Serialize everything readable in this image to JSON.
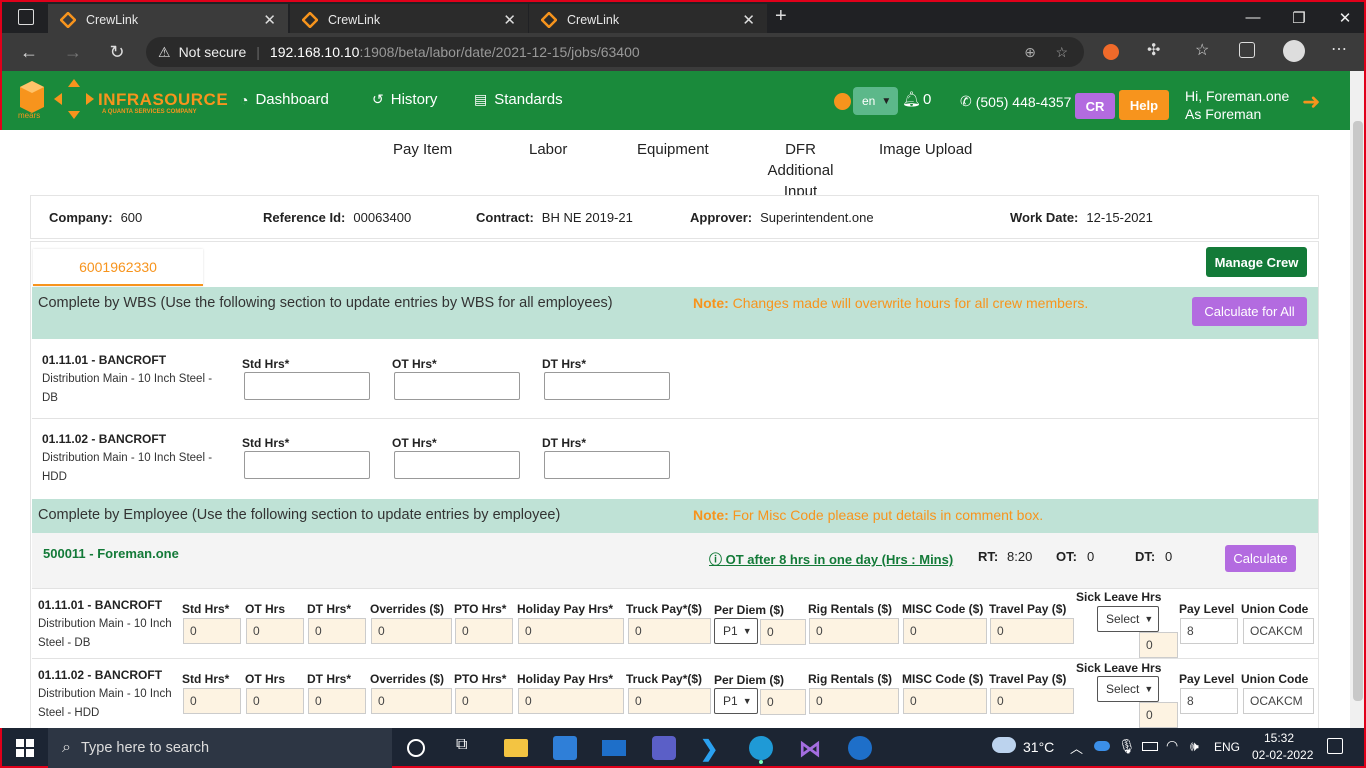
{
  "browser": {
    "tabs": [
      {
        "title": "CrewLink"
      },
      {
        "title": "CrewLink"
      },
      {
        "title": "CrewLink"
      }
    ],
    "security_label": "Not secure",
    "url_host": "192.168.10.10",
    "url_path": ":1908/beta/labor/date/2021-12-15/jobs/63400"
  },
  "header": {
    "logo_text": "INFRASOURCE",
    "logo_sub": "A QUANTA SERVICES COMPANY",
    "logo_mears": "mears",
    "nav": [
      {
        "label": "Dashboard",
        "icon": "dashboard-icon"
      },
      {
        "label": "History",
        "icon": "history-icon"
      },
      {
        "label": "Standards",
        "icon": "document-icon"
      }
    ],
    "language": "en",
    "notif_count": "0",
    "phone": "(505) 448-4357",
    "cr_label": "CR",
    "help_label": "Help",
    "greeting": "Hi, Foreman.one",
    "role": "As Foreman"
  },
  "subnav": {
    "items": [
      "Pay Item",
      "Labor",
      "Equipment",
      "DFR Additional",
      "Input",
      "Image Upload"
    ]
  },
  "info": {
    "company_label": "Company:",
    "company": "600",
    "ref_label": "Reference Id:",
    "ref": "00063400",
    "contract_label": "Contract:",
    "contract": "BH NE 2019-21",
    "approver_label": "Approver:",
    "approver": "Superintendent.one",
    "date_label": "Work Date:",
    "date": "12-15-2021"
  },
  "crew": {
    "tab_id": "6001962330",
    "manage_label": "Manage Crew",
    "wbs_title": "Complete by WBS (Use the following section to update entries by WBS for all employees)",
    "note_label": "Note:",
    "wbs_note": "Changes made will overwrite hours for all crew members.",
    "calc_all_label": "Calculate for All",
    "wbs_rows": [
      {
        "code": "01.11.01 - BANCROFT",
        "desc1": "Distribution Main - 10 Inch Steel -",
        "desc2": "DB"
      },
      {
        "code": "01.11.02 - BANCROFT",
        "desc1": "Distribution Main - 10 Inch Steel -",
        "desc2": "HDD"
      }
    ],
    "wbs_fields": [
      "Std Hrs*",
      "OT Hrs*",
      "DT Hrs*"
    ],
    "emp_title": "Complete by Employee (Use the following section to update entries by employee)",
    "emp_note": "For Misc Code please put details in comment box.",
    "employee": "500011 - Foreman.one",
    "ot_rule": "OT after 8 hrs in one day (Hrs : Mins)",
    "rt_label": "RT:",
    "rt": "8:20",
    "ot_label": "OT:",
    "ot": "0",
    "dt_label": "DT:",
    "dt": "0",
    "calc_label": "Calculate",
    "emp_fields": [
      "Std Hrs*",
      "OT Hrs",
      "DT Hrs*",
      "Overrides ($)",
      "PTO Hrs*",
      "Holiday Pay Hrs*",
      "Truck Pay*($)",
      "Per Diem ($)",
      "Rig Rentals ($)",
      "MISC Code ($)",
      "Travel Pay ($)",
      "Sick Leave Hrs",
      "Pay Level",
      "Union Code"
    ],
    "emp_rows": [
      {
        "code": "01.11.01 - BANCROFT",
        "desc1": "Distribution Main - 10 Inch",
        "desc2": "Steel - DB",
        "std": "0",
        "othrs": "0",
        "dthrs": "0",
        "overrides": "0",
        "pto": "0",
        "holiday": "0",
        "truck": "0",
        "perdiem_sel": "P1",
        "perdiem": "0",
        "rig": "0",
        "misc": "0",
        "travel": "0",
        "sick_sel": "Select",
        "sick": "0",
        "paylevel": "8",
        "union": "OCAKCM"
      },
      {
        "code": "01.11.02 - BANCROFT",
        "desc1": "Distribution Main - 10 Inch",
        "desc2": "Steel - HDD",
        "std": "0",
        "othrs": "0",
        "dthrs": "0",
        "overrides": "0",
        "pto": "0",
        "holiday": "0",
        "truck": "0",
        "perdiem_sel": "P1",
        "perdiem": "0",
        "rig": "0",
        "misc": "0",
        "travel": "0",
        "sick_sel": "Select",
        "sick": "0",
        "paylevel": "8",
        "union": "OCAKCM"
      }
    ]
  },
  "taskbar": {
    "search_placeholder": "Type here to search",
    "weather": "31°C",
    "lang": "ENG",
    "time": "15:32",
    "date": "02-02-2022"
  },
  "colors": {
    "brand_green": "#1a8a3b",
    "orange": "#f7941d",
    "purple": "#b36be0",
    "band": "#bfe2d6"
  }
}
